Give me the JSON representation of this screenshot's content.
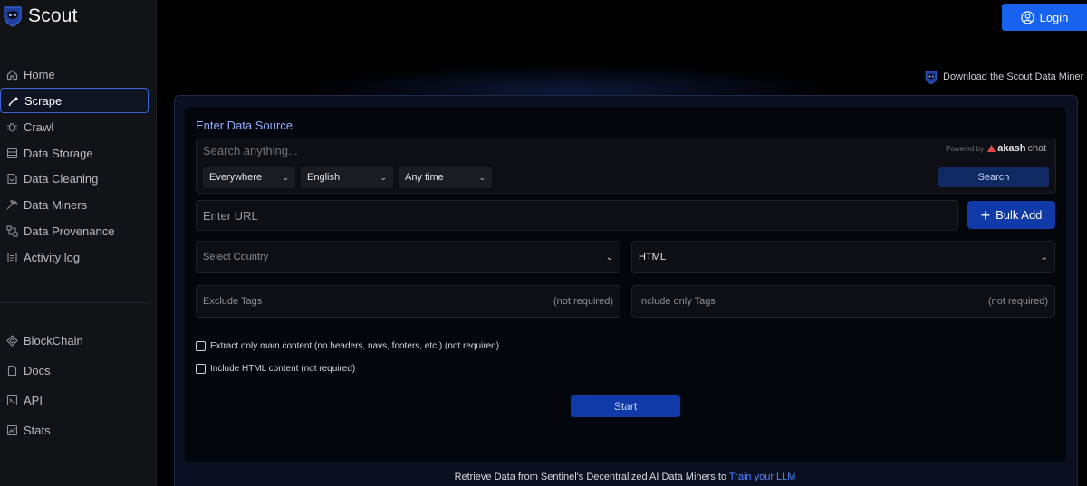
{
  "app": {
    "name": "Scout",
    "accent": "#1763f0"
  },
  "sidebar": {
    "items": [
      {
        "label": "Home",
        "icon": "home-icon"
      },
      {
        "label": "Scrape",
        "icon": "scrape-icon",
        "active": true
      },
      {
        "label": "Crawl",
        "icon": "bug-icon"
      },
      {
        "label": "Data Storage",
        "icon": "storage-icon"
      },
      {
        "label": "Data Cleaning",
        "icon": "cleaning-icon"
      },
      {
        "label": "Data Miners",
        "icon": "miners-icon"
      },
      {
        "label": "Data Provenance",
        "icon": "provenance-icon"
      },
      {
        "label": "Activity log",
        "icon": "activity-log-icon"
      }
    ],
    "bottom_items": [
      {
        "label": "BlockChain",
        "icon": "blockchain-icon"
      },
      {
        "label": "Docs",
        "icon": "docs-icon"
      },
      {
        "label": "API",
        "icon": "api-icon"
      },
      {
        "label": "Stats",
        "icon": "stats-icon"
      }
    ]
  },
  "header": {
    "login_label": "Login",
    "download_label": "Download the Scout Data Miner"
  },
  "form": {
    "section_title": "Enter Data Source",
    "search_placeholder": "Search anything...",
    "powered_by": "Powered by",
    "akash": "akash",
    "akash_chat": "chat",
    "dropdowns": {
      "scope": "Everywhere",
      "language": "English",
      "time": "Any time"
    },
    "search_button": "Search",
    "url_placeholder": "Enter URL",
    "bulk_add": "Bulk Add",
    "country_placeholder": "Select Country",
    "format_value": "HTML",
    "exclude_tags": "Exclude Tags",
    "include_tags": "Include only Tags",
    "not_required": "(not required)",
    "check_main_content": "Extract only main content (no headers, navs, footers, etc.) (not required)",
    "check_html": "Include HTML content (not required)",
    "start_button": "Start"
  },
  "footer": {
    "text": "Retrieve Data from Sentinel's Decentralized AI Data Miners to ",
    "link": "Train your LLM"
  }
}
